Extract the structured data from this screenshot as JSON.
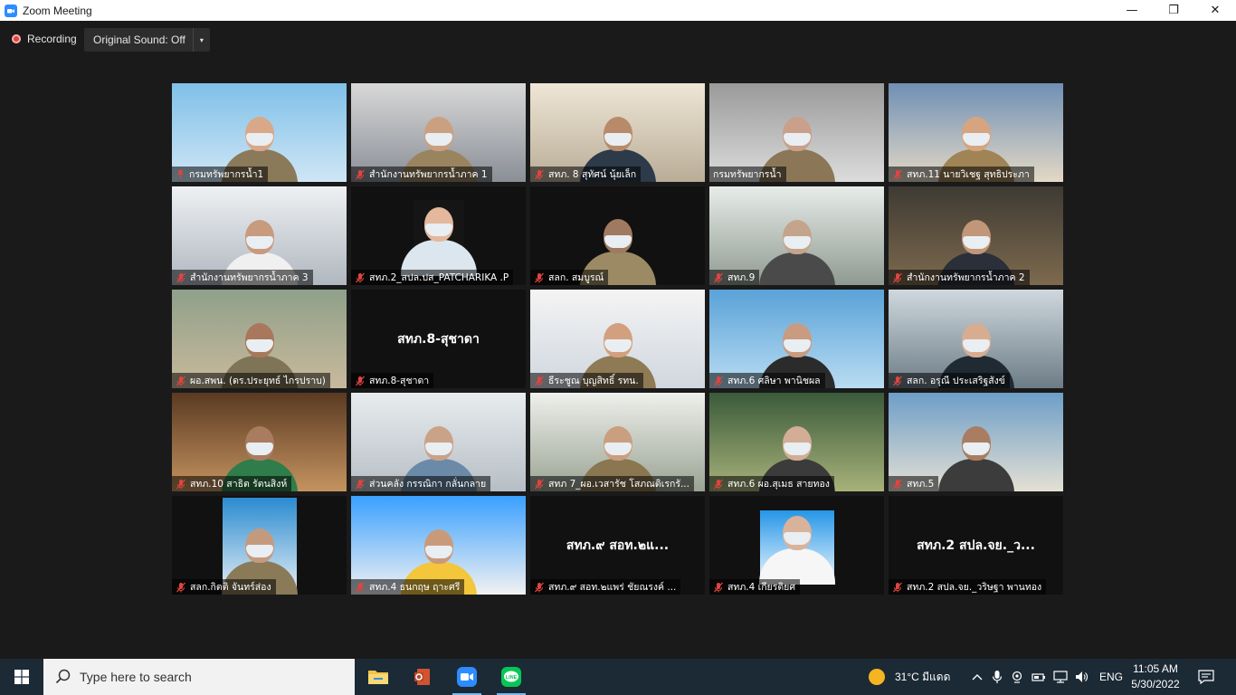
{
  "window": {
    "title": "Zoom Meeting",
    "minimize": "—",
    "restore": "❐",
    "close": "✕"
  },
  "toolbar": {
    "recording_label": "Recording",
    "sound_label": "Original Sound: Off",
    "dropdown_glyph": "▾"
  },
  "participants": [
    {
      "name": "กรมทรัพยากรน้ำ1",
      "muted": false,
      "pinned": true
    },
    {
      "name": "สำนักงานทรัพยากรน้ำภาค 1",
      "muted": true
    },
    {
      "name": "สทภ. 8 สุทัศน์ นุ้ยเล็ก",
      "muted": true
    },
    {
      "name": "กรมทรัพยากรน้ำ",
      "muted": false,
      "active": true
    },
    {
      "name": "สทภ.11 นายวิเชฐ สุทธิประภา",
      "muted": true
    },
    {
      "name": "สำนักงานทรัพยากรน้ำภาค 3",
      "muted": true
    },
    {
      "name": "สทภ.2_สปล.ปส_PATCHARIKA .P",
      "muted": true
    },
    {
      "name": "สลก. สมบูรณ์",
      "muted": true
    },
    {
      "name": "สทภ.9",
      "muted": true
    },
    {
      "name": "สำนักงานทรัพยากรน้ำภาค 2",
      "muted": true
    },
    {
      "name": "ผอ.สพน. (ดร.ประยุทธ์  ไกรปราบ)",
      "muted": true
    },
    {
      "name": "สทภ.8-สุชาดา",
      "muted": true,
      "display": "สทภ.8-สุชาดา"
    },
    {
      "name": "ธีระชูณ บุญสิทธิ์ รทน.",
      "muted": true
    },
    {
      "name": "สทภ.6 ศลิษา พานิชผล",
      "muted": true
    },
    {
      "name": "สลก. อรุณี ประเสริฐสังข์",
      "muted": true
    },
    {
      "name": "สทภ.10 สาธิต  รัตนสิงห์",
      "muted": true
    },
    {
      "name": "ส่วนคลัง กรรณิกา กลั่นกลาย",
      "muted": true
    },
    {
      "name": "สทภ 7_ผอ.เวสารัช โสภณดิเรกรั...",
      "muted": true
    },
    {
      "name": "สทภ.6 ผอ.สุเมธ สายทอง",
      "muted": true
    },
    {
      "name": "สทภ.5",
      "muted": true
    },
    {
      "name": "สลก.กิตติ จันทร์ส่อง",
      "muted": true
    },
    {
      "name": "สทภ.4 ธนกฤษ ฤาะศรี",
      "muted": true
    },
    {
      "name": "สทภ.๙ สอท.๒แพร่ ชัยณรงค์ ...",
      "muted": true,
      "display": "สทภ.๙ สอท.๒แ..."
    },
    {
      "name": "สทภ.4 เกียรติยศ",
      "muted": true
    },
    {
      "name": "สทภ.2 สปล.จย._วริษฐา พานทอง",
      "muted": true,
      "display": "สทภ.2 สปล.จย._ว..."
    }
  ],
  "taskbar": {
    "search_placeholder": "Type here to search",
    "apps": [
      "file-explorer",
      "office",
      "zoom",
      "line"
    ],
    "line_label": "LINE",
    "weather": "31°C  มีแดด",
    "language": "ENG",
    "time": "11:05 AM",
    "date": "5/30/2022"
  },
  "colors": {
    "accent_active": "#d8d84c",
    "taskbar": "#1c2a36",
    "mute_red": "#e0443e"
  }
}
